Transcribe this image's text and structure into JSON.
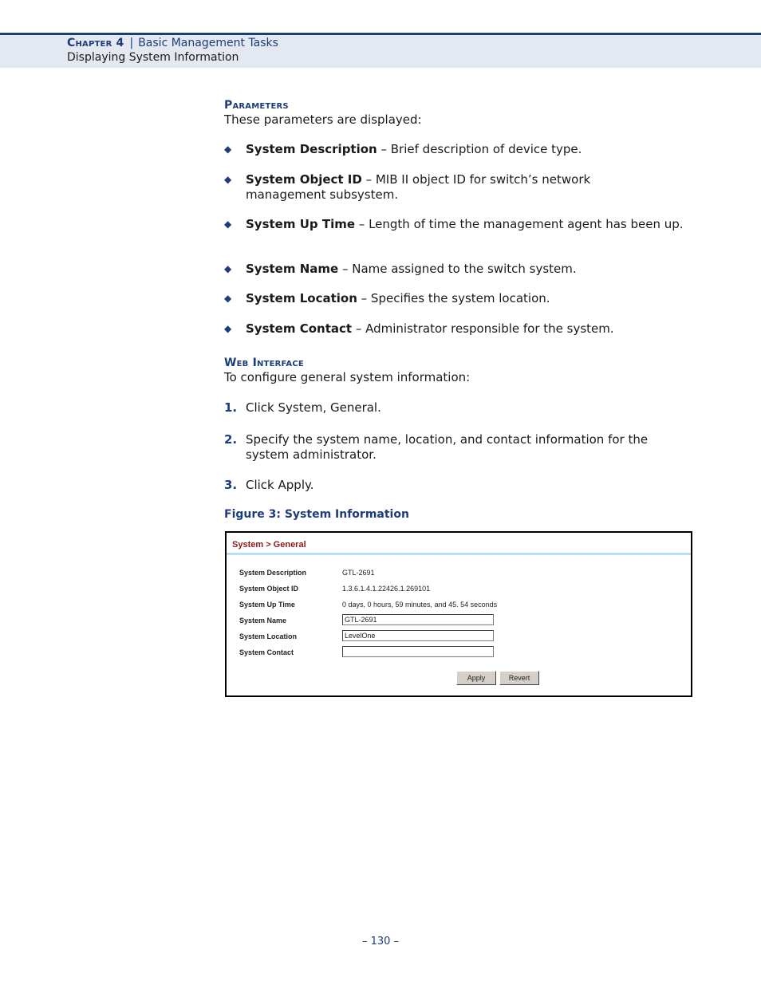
{
  "header": {
    "chapter_label": "Chapter 4",
    "separator": "|",
    "chapter_title": "Basic Management Tasks",
    "section_title": "Displaying System Information"
  },
  "parameters": {
    "heading": "Parameters",
    "intro": "These parameters are displayed:",
    "bullet_icon": "diamond-bullet-icon",
    "items": [
      {
        "term": "System Description",
        "desc": " – Brief description of device type."
      },
      {
        "term": "System Object ID",
        "desc": " – MIB II object ID for switch’s network management subsystem."
      },
      {
        "term": "System Up Time",
        "desc": " – Length of time the management agent has been up."
      },
      {
        "term": "System Name",
        "desc": " – Name assigned to the switch system."
      },
      {
        "term": "System Location",
        "desc": " – Specifies the system location."
      },
      {
        "term": "System Contact",
        "desc": " – Administrator responsible for the system."
      }
    ]
  },
  "web_interface": {
    "heading": "Web Interface",
    "intro": "To configure general system information:",
    "steps": [
      {
        "num": "1.",
        "text": "Click System, General."
      },
      {
        "num": "2.",
        "text": "Specify the system name, location, and contact information for the system administrator."
      },
      {
        "num": "3.",
        "text": "Click Apply."
      }
    ]
  },
  "figure": {
    "caption": "Figure 3:  System Information",
    "breadcrumb": "System > General",
    "fields": [
      {
        "label": "System Description",
        "value": "GTL-2691"
      },
      {
        "label": "System Object ID",
        "value": "1.3.6.1.4.1.22426.1.269101"
      },
      {
        "label": "System Up Time",
        "value": "0 days, 0 hours, 59 minutes, and 45. 54 seconds"
      },
      {
        "label": "System Name",
        "input_value": "GTL-2691"
      },
      {
        "label": "System Location",
        "input_value": "LevelOne"
      },
      {
        "label": "System Contact",
        "input_value": ""
      }
    ],
    "buttons": {
      "apply": "Apply",
      "revert": "Revert"
    }
  },
  "footer": {
    "page_number": "–  130  –"
  },
  "colors": {
    "accent": "#1c3d7a",
    "header_band": "#e4e8f0",
    "breadcrumb": "#8b1a1a"
  }
}
